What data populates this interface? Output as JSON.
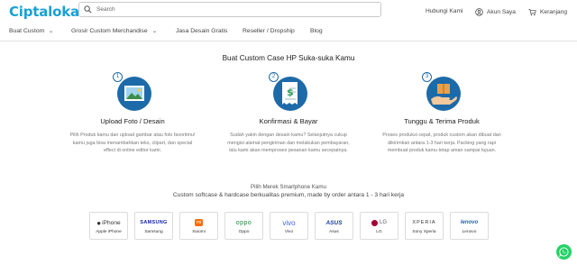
{
  "header": {
    "logo": "Ciptaloka",
    "search": {
      "placeholder": "Search",
      "value": ""
    },
    "links": {
      "contact": "Hubungi Kami",
      "account": "Akun Saya",
      "cart": "Keranjang"
    }
  },
  "nav": {
    "items": [
      {
        "label": "Buat Custom",
        "dropdown": true
      },
      {
        "label": "Grosir Custom Merchandise",
        "dropdown": true
      },
      {
        "label": "Jasa Desain Gratis",
        "dropdown": false
      },
      {
        "label": "Reseller / Dropship",
        "dropdown": false
      },
      {
        "label": "Blog",
        "dropdown": false
      }
    ]
  },
  "main": {
    "title": "Buat Custom Case HP Suka-suka Kamu",
    "steps": [
      {
        "number": "1",
        "title": "Upload Foto / Desain",
        "icon": "photo-upload-icon",
        "text": "Pilih Produk kamu dan upload gambar atau foto favoritmu! kamu juga bisa menambahkan teks, clipart, dan special effect di online editor kami."
      },
      {
        "number": "2",
        "title": "Konfirmasi & Bayar",
        "icon": "payment-icon",
        "text": "Sudah yakin dengan desain kamu? Selanjutnya cukup mengisi alamat pengiriman dan melakukan pembayaran, lalu kami akan memproses pesanan kamu secepatnya."
      },
      {
        "number": "3",
        "title": "Tunggu & Terima Produk",
        "icon": "package-icon",
        "text": "Proses produksi cepat, produk custom akan dibuat dan dikirimkan antara 1-3 hari kerja. Packing yang rapi membuat produk kamu tetap aman sampai tujuan."
      }
    ],
    "brand_heading": "Pilih Merek Smartphone Kamu",
    "brand_subheading": "Custom softcase & hardcase berkualitas premium, made by order antara 1 - 3 hari kerja",
    "brands": [
      {
        "logo": "iPhone",
        "name": "Apple iPhone",
        "color": "#222222"
      },
      {
        "logo": "SAMSUNG",
        "name": "Samsung",
        "color": "#1428a0"
      },
      {
        "logo": "mi",
        "name": "Xiaomi",
        "color": "#ff6900"
      },
      {
        "logo": "oppo",
        "name": "Oppo",
        "color": "#1a8c3c"
      },
      {
        "logo": "vivo",
        "name": "Vivo",
        "color": "#415fff"
      },
      {
        "logo": "ASUS",
        "name": "Asus",
        "color": "#1a3f9f"
      },
      {
        "logo": "LG",
        "name": "LG",
        "color": "#a50034"
      },
      {
        "logo": "XPERIA",
        "name": "Sony Xperia",
        "color": "#333333"
      },
      {
        "logo": "lenovo",
        "name": "Lenovo",
        "color": "#2a5fb8"
      }
    ]
  },
  "colors": {
    "brand": "#1aa1d6",
    "accent_blue": "#1d6aa8",
    "whatsapp": "#25d366"
  },
  "floating": {
    "icon": "whatsapp-icon"
  }
}
